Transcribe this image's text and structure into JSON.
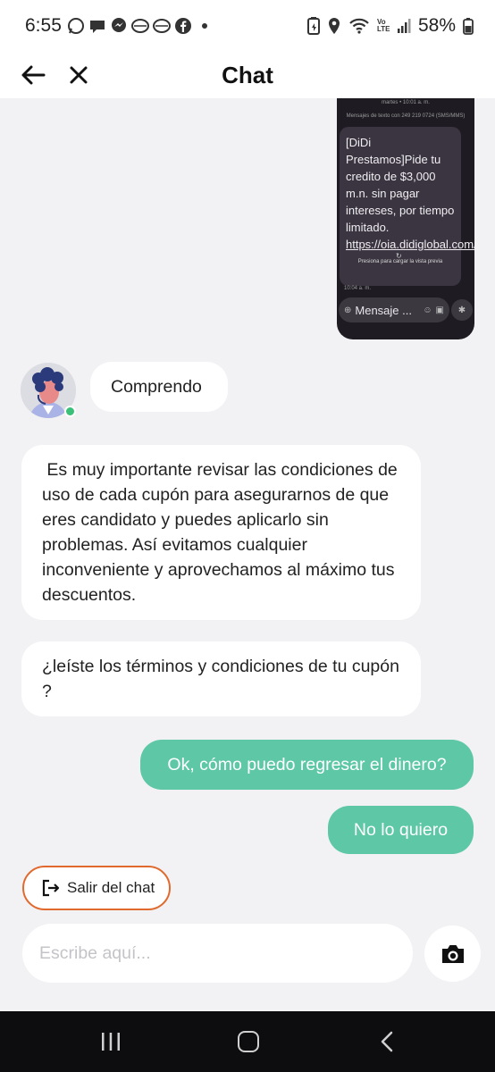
{
  "status_bar": {
    "time": "6:55",
    "battery": "58%",
    "notification_icons": [
      "whatsapp-icon",
      "chat-bubble-icon",
      "messenger-icon",
      "app-icon",
      "app-icon",
      "facebook-icon",
      "dot-icon"
    ],
    "system_icons": [
      "battery-saver-icon",
      "location-icon",
      "wifi-icon",
      "volte-icon",
      "signal-icon",
      "battery-icon"
    ],
    "volte_label": "Vo LTE"
  },
  "header": {
    "title": "Chat",
    "back_icon": "arrow-left-icon",
    "close_icon": "close-icon"
  },
  "attachment": {
    "date": "martes • 10:01 a. m.",
    "thread_info": "Mensajes de texto con 249 219 0724 (SMS/MMS)",
    "sms_text": "[DiDi Prestamos]Pide tu credito de $3,000 m.n. sin pagar intereses, por tiempo limitado.",
    "sms_link": "https://oia.didiglobal.com/g/D7PBAeP",
    "preview_hint": "Presiona para cargar la vista previa",
    "time": "10:04 a. m.",
    "input_placeholder": "Mensaje ..."
  },
  "messages": {
    "incoming_1": "Comprendo",
    "incoming_2": " Es muy importante revisar las condiciones de uso de cada cupón para asegurarnos de que eres candidato y puedes aplicarlo sin problemas. Así evitamos cualquier inconveniente y aprovechamos al máximo tus descuentos.",
    "incoming_3": "¿leíste los términos y condiciones de tu cupón ?",
    "outgoing_1": "Ok, cómo puedo regresar el dinero?",
    "outgoing_2": "No lo quiero"
  },
  "actions": {
    "exit_chat_label": "Salir del chat"
  },
  "composer": {
    "placeholder": "Escribe aquí...",
    "camera_icon": "camera-icon"
  },
  "colors": {
    "outgoing_bubble": "#5ec8a6",
    "exit_border": "#e06a2e",
    "online": "#3bc07a",
    "background": "#f2f2f4"
  }
}
